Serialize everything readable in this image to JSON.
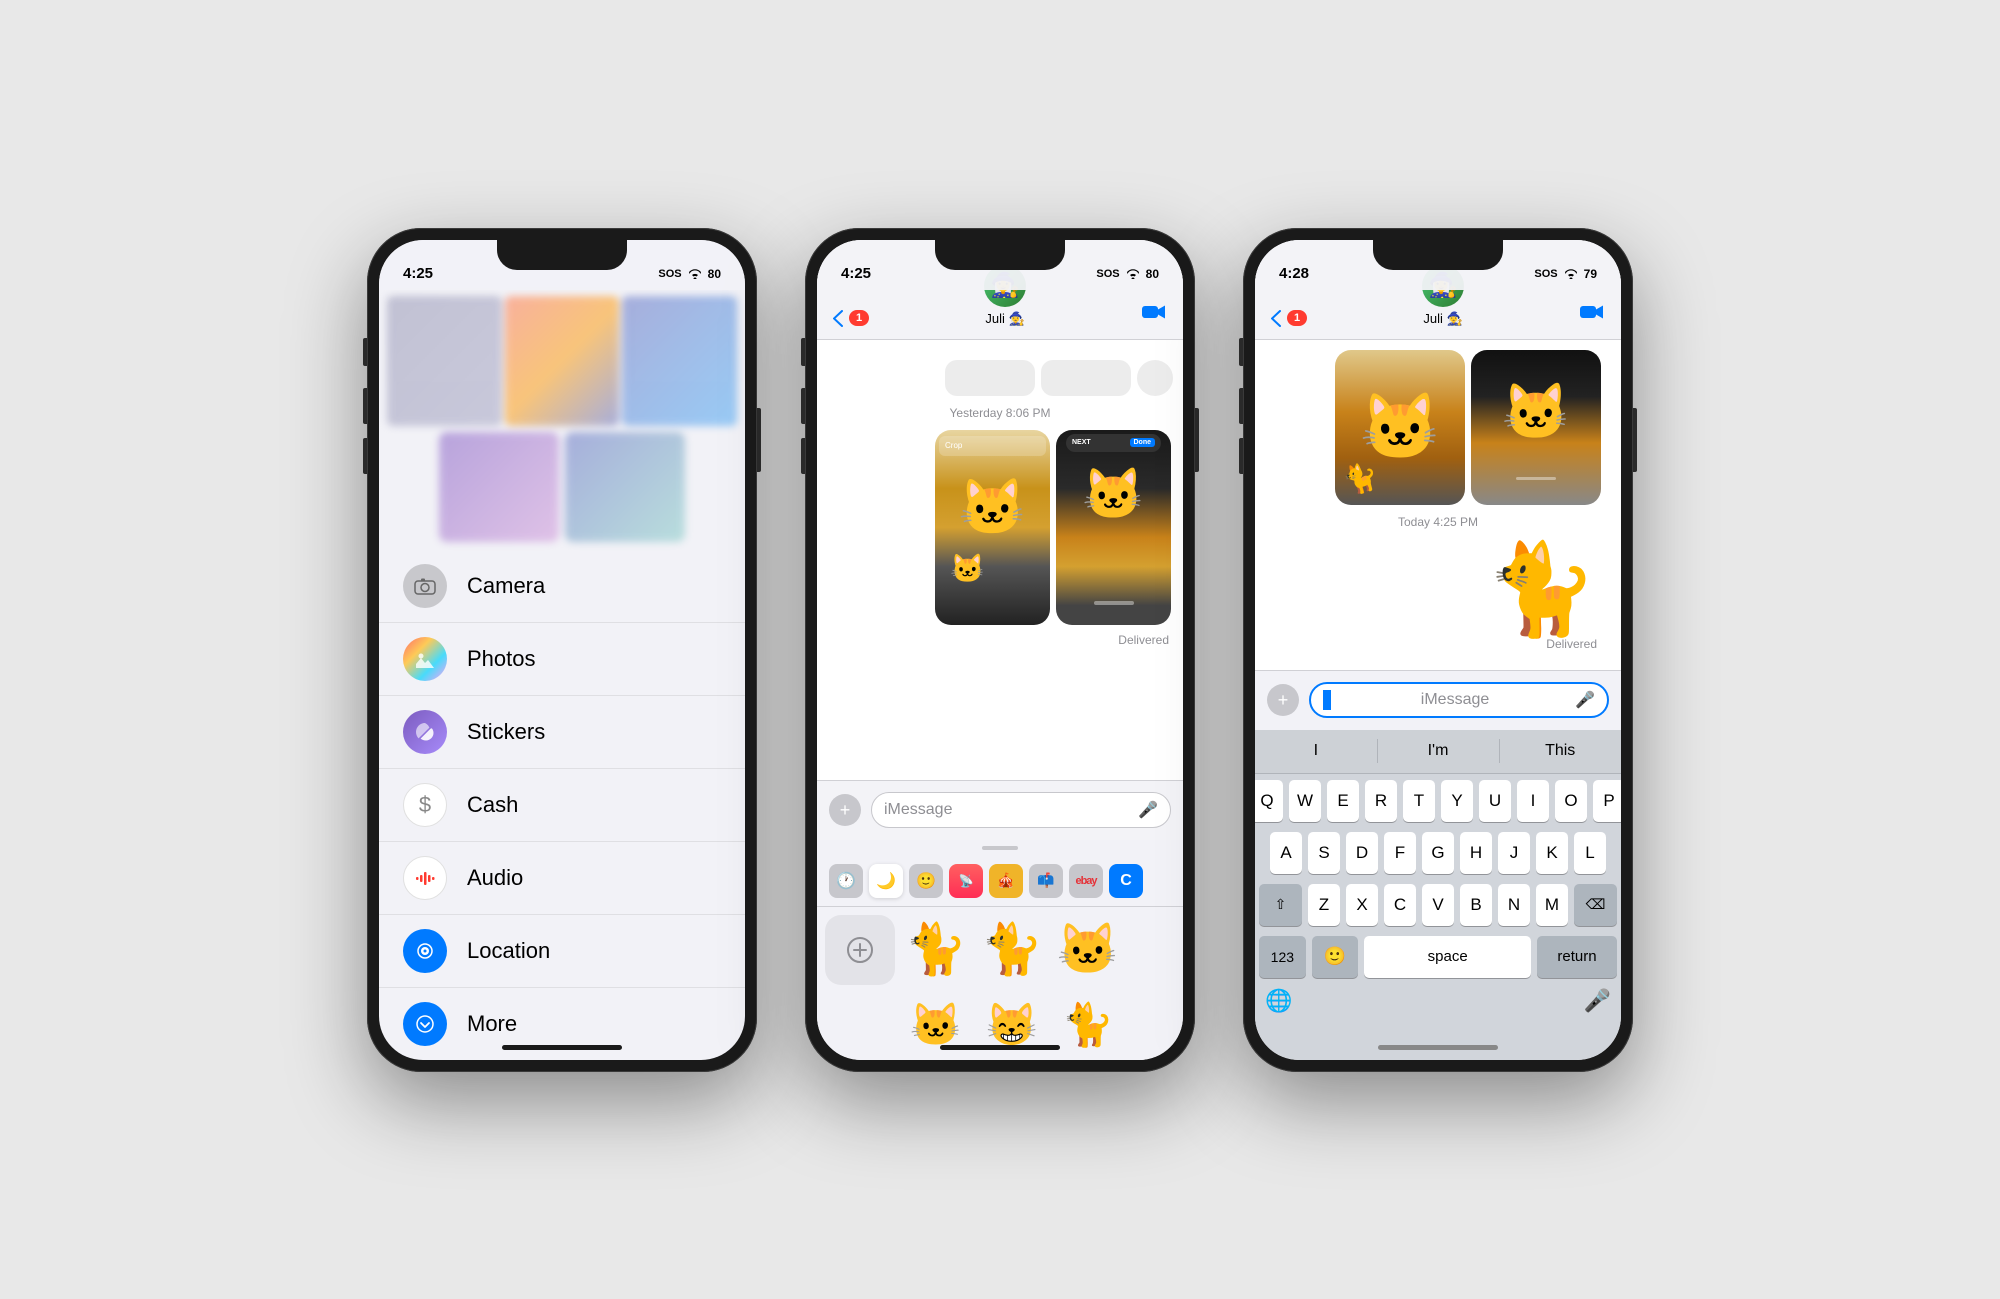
{
  "phones": {
    "phone1": {
      "status_bar": {
        "time": "4:25",
        "right_icons": "SOS ⟴ 80"
      },
      "menu_items": [
        {
          "id": "camera",
          "label": "Camera",
          "icon_type": "camera",
          "icon_char": "📷"
        },
        {
          "id": "photos",
          "label": "Photos",
          "icon_type": "photos",
          "icon_char": "🌄"
        },
        {
          "id": "stickers",
          "label": "Stickers",
          "icon_type": "stickers",
          "icon_char": "🌀"
        },
        {
          "id": "cash",
          "label": "Cash",
          "icon_type": "cash",
          "icon_char": "$"
        },
        {
          "id": "audio",
          "label": "Audio",
          "icon_type": "audio",
          "icon_char": "🎙️"
        },
        {
          "id": "location",
          "label": "Location",
          "icon_type": "location",
          "icon_char": "●"
        },
        {
          "id": "more",
          "label": "More",
          "icon_type": "more",
          "icon_char": "↓"
        }
      ]
    },
    "phone2": {
      "status_bar": {
        "time": "4:25",
        "right_icons": "SOS ⟴ 80"
      },
      "header": {
        "back_label": "1",
        "contact_name": "Juli 🧙‍♀️",
        "avatar_emoji": "🧙‍♀️"
      },
      "timestamp": "Yesterday 8:06 PM",
      "delivered": "Delivered",
      "input_placeholder": "iMessage",
      "sticker_tabs": [
        "🕐",
        "🌙",
        "🙂",
        "🦜",
        "🎪",
        "📫",
        "eb",
        "C"
      ],
      "sticker_rows": [
        [
          "cat_medium",
          "cat_sitting"
        ],
        [
          "cat_walking",
          "cat_screen",
          "cat_yawning"
        ]
      ]
    },
    "phone3": {
      "status_bar": {
        "time": "4:28",
        "right_icons": "SOS ⟴ 79"
      },
      "header": {
        "back_label": "1",
        "contact_name": "Juli 🧙‍♀️",
        "avatar_emoji": "🧙‍♀️"
      },
      "timestamp": "Today 4:25 PM",
      "delivered": "Delivered",
      "input_placeholder": "iMessage",
      "keyboard": {
        "suggestions": [
          "I",
          "I'm",
          "This"
        ],
        "row1": [
          "Q",
          "W",
          "E",
          "R",
          "T",
          "Y",
          "U",
          "I",
          "O",
          "P"
        ],
        "row2": [
          "A",
          "S",
          "D",
          "F",
          "G",
          "H",
          "J",
          "K",
          "L"
        ],
        "row3": [
          "Z",
          "X",
          "C",
          "V",
          "B",
          "N",
          "M"
        ],
        "row4_123": "123",
        "row4_space": "space",
        "row4_return": "return",
        "shift": "⇧",
        "backspace": "⌫",
        "emoji": "🙂",
        "numbers": "123",
        "globe": "🌐"
      }
    }
  }
}
